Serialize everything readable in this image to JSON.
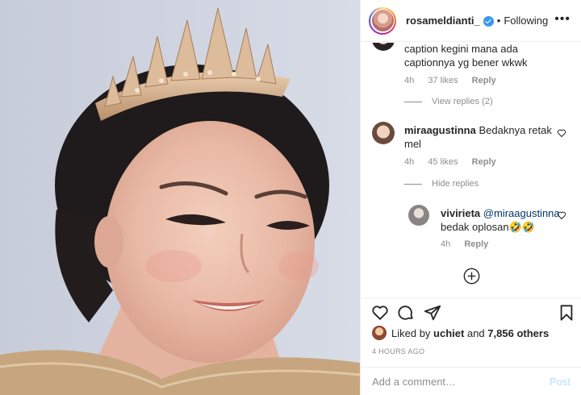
{
  "header": {
    "username": "rosameldianti_",
    "separator": "•",
    "follow_status": "Following",
    "more": "•••"
  },
  "comments": [
    {
      "text_line1": "caption kegini mana ada",
      "text_line2": "captionnya yg bener wkwk",
      "time": "4h",
      "likes": "37 likes",
      "reply": "Reply",
      "replies_toggle": "View replies (2)"
    },
    {
      "username": "miraagustinna",
      "text_line1": "Bedaknya retak",
      "text_line2": "mel",
      "time": "4h",
      "likes": "45 likes",
      "reply": "Reply",
      "replies_toggle": "Hide replies"
    }
  ],
  "reply": {
    "username": "vivirieta",
    "mention": "@miraagustinna",
    "text": "bedak oplosan🤣🤣",
    "time": "4h",
    "reply": "Reply"
  },
  "likes": {
    "prefix": "Liked by",
    "user": "uchiet",
    "joiner": "and",
    "others": "7,856 others"
  },
  "timestamp": "4 HOURS AGO",
  "add_comment": {
    "placeholder": "Add a comment…",
    "post": "Post"
  },
  "colors": {
    "verified": "#3897f0",
    "post_disabled": "#b2dffc",
    "meta": "#8e8e8e"
  }
}
